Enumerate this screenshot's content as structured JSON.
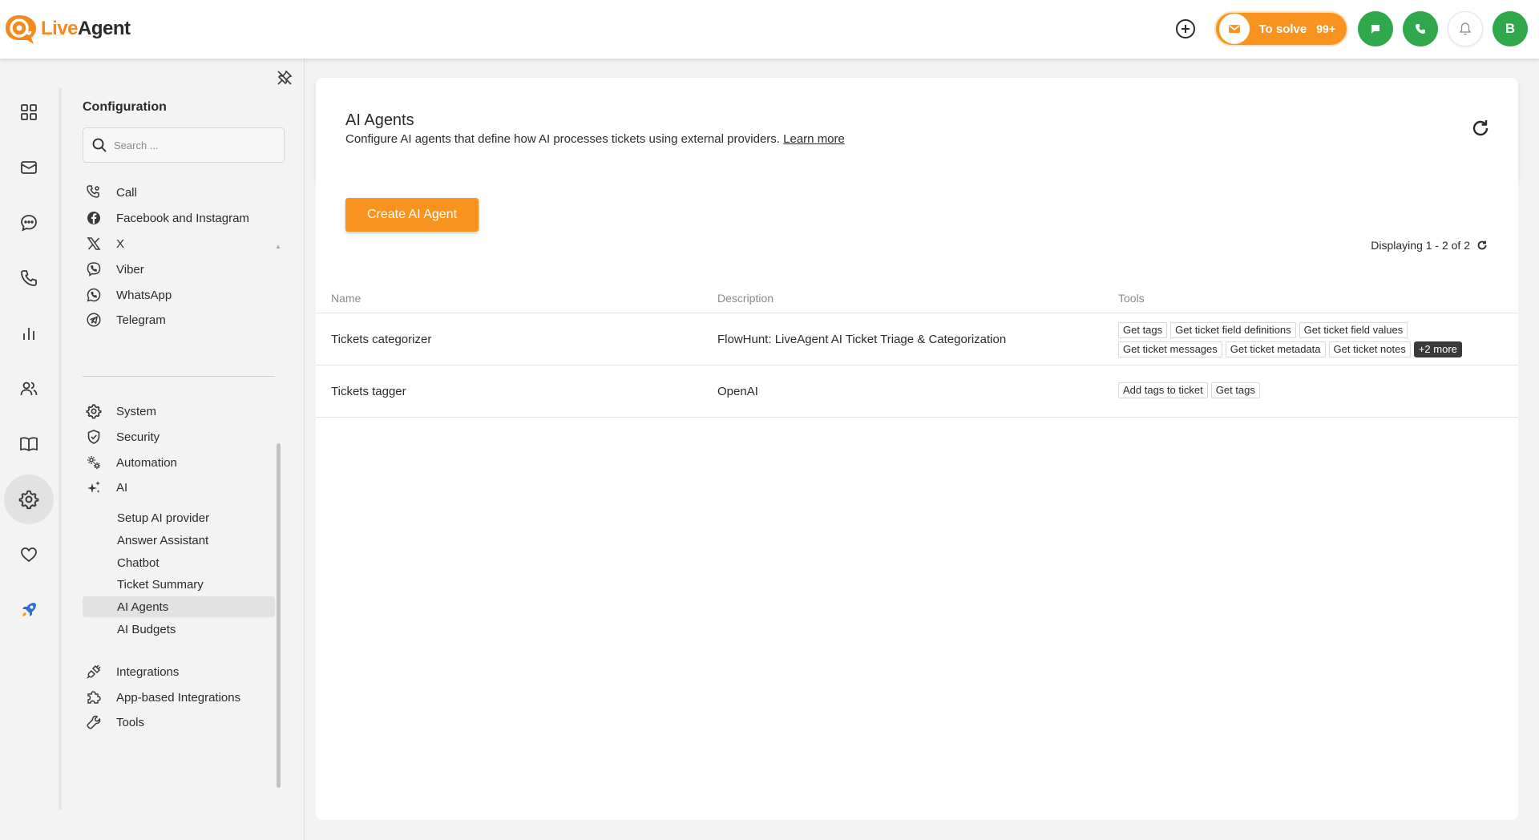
{
  "app": {
    "logo_live": "Live",
    "logo_agent": "Agent"
  },
  "topbar": {
    "to_solve_label": "To solve",
    "to_solve_count": "99+",
    "avatar_initial": "B"
  },
  "config": {
    "title": "Configuration",
    "search_placeholder": "Search ...",
    "channels": [
      {
        "label": "Call",
        "icon": "call-settings-icon"
      },
      {
        "label": "Facebook and Instagram",
        "icon": "facebook-icon"
      },
      {
        "label": "X",
        "icon": "x-logo-icon"
      },
      {
        "label": "Viber",
        "icon": "viber-icon"
      },
      {
        "label": "WhatsApp",
        "icon": "whatsapp-icon"
      },
      {
        "label": "Telegram",
        "icon": "telegram-icon"
      }
    ],
    "sections": [
      {
        "label": "System",
        "icon": "gear-icon"
      },
      {
        "label": "Security",
        "icon": "shield-icon"
      },
      {
        "label": "Automation",
        "icon": "automation-gears-icon"
      },
      {
        "label": "AI",
        "icon": "sparkle-icon"
      }
    ],
    "ai_subitems": [
      "Setup AI provider",
      "Answer Assistant",
      "Chatbot",
      "Ticket Summary",
      "AI Agents",
      "AI Budgets"
    ],
    "ai_active": "AI Agents",
    "bottom": [
      {
        "label": "Integrations",
        "icon": "plug-icon"
      },
      {
        "label": "App-based Integrations",
        "icon": "puzzle-icon"
      },
      {
        "label": "Tools",
        "icon": "wrench-icon"
      }
    ]
  },
  "main": {
    "title": "AI Agents",
    "description": "Configure AI agents that define how AI processes tickets using external providers.",
    "learn_more": "Learn more",
    "create_button": "Create AI Agent",
    "displaying": "Displaying 1 - 2 of 2",
    "columns": [
      "Name",
      "Description",
      "Tools"
    ],
    "rows": [
      {
        "name": "Tickets categorizer",
        "description": "FlowHunt: LiveAgent AI Ticket Triage & Categorization",
        "tools": [
          "Get tags",
          "Get ticket field definitions",
          "Get ticket field values",
          "Get ticket messages",
          "Get ticket metadata",
          "Get ticket notes"
        ],
        "more": "+2 more"
      },
      {
        "name": "Tickets tagger",
        "description": "OpenAI",
        "tools": [
          "Add tags to ticket",
          "Get tags"
        ],
        "more": ""
      }
    ]
  },
  "colors": {
    "accent": "#f7931e",
    "green": "#2ea84a"
  }
}
